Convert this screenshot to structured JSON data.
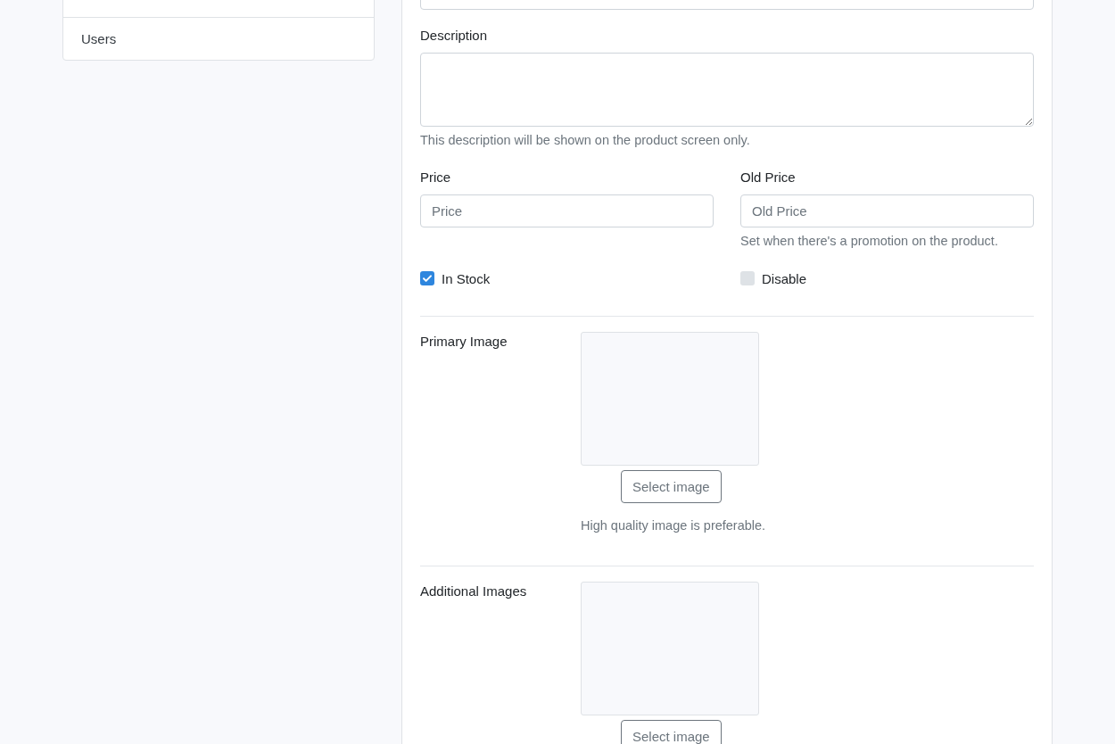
{
  "sidebar": {
    "items": [
      {
        "label": "Users"
      }
    ]
  },
  "form": {
    "description": {
      "label": "Description",
      "help": "This description will be shown on the product screen only."
    },
    "price": {
      "label": "Price",
      "placeholder": "Price"
    },
    "old_price": {
      "label": "Old Price",
      "placeholder": "Old Price",
      "help": "Set when there's a promotion on the product."
    },
    "checkboxes": [
      {
        "label": "In Stock",
        "checked": true
      },
      {
        "label": "Disable",
        "checked": false
      }
    ],
    "image_sections": [
      {
        "label": "Primary Image",
        "button": "Select image",
        "help": "High quality image is preferable."
      },
      {
        "label": "Additional Images",
        "button": "Select image"
      }
    ]
  }
}
